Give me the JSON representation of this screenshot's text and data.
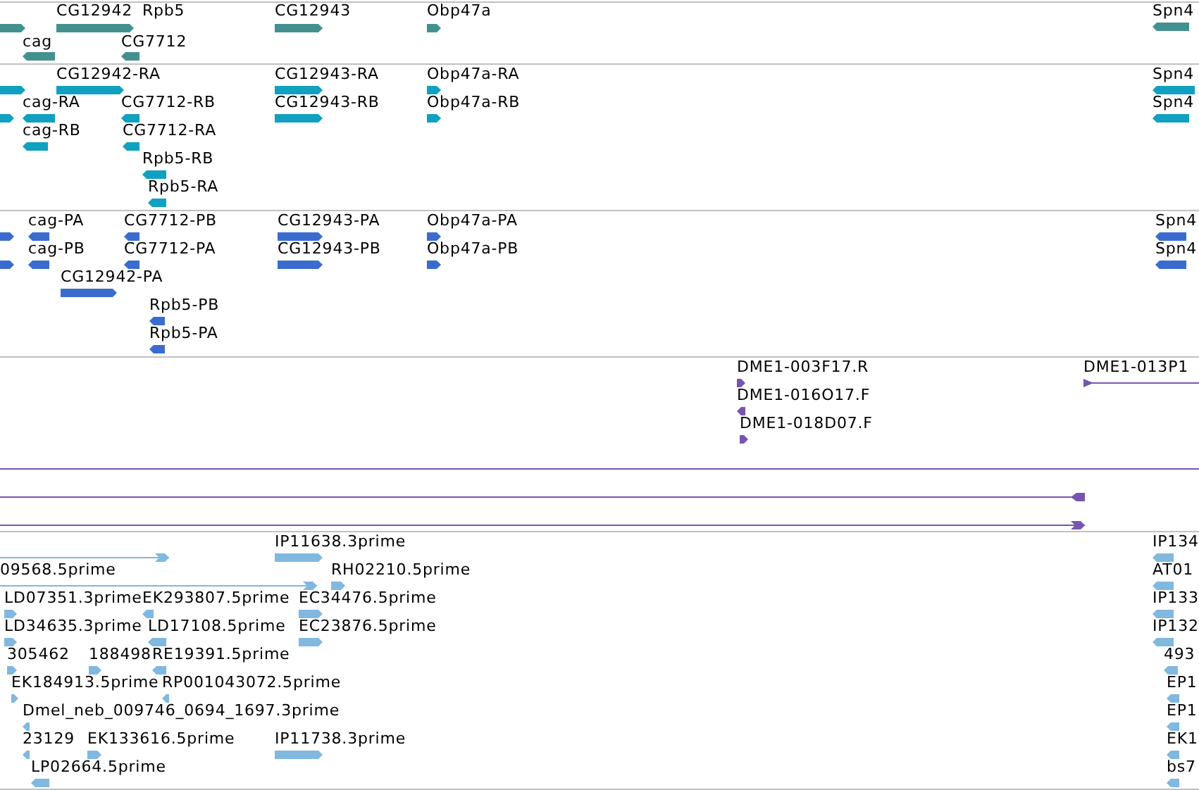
{
  "tracks": [
    {
      "color": "#43918f",
      "features": [
        {
          "kind": "block",
          "reverse": false
        },
        {
          "label": "CG12942",
          "kind": "block",
          "reverse": false
        },
        {
          "label": "Rpb5",
          "kind": "label"
        },
        {
          "label": "CG12943",
          "kind": "block",
          "reverse": false
        },
        {
          "label": "Obp47a",
          "kind": "block",
          "reverse": false
        },
        {
          "label": "Spn4",
          "kind": "block",
          "reverse": true
        },
        {
          "label": "cag",
          "kind": "block",
          "reverse": true
        },
        {
          "label": "CG7712",
          "kind": "block",
          "reverse": true
        }
      ]
    },
    {
      "color": "#10a0c0",
      "features": [
        {
          "kind": "block",
          "reverse": false
        },
        {
          "label": "CG12942-RA",
          "kind": "block",
          "reverse": false
        },
        {
          "label": "CG12943-RA",
          "kind": "block",
          "reverse": false
        },
        {
          "label": "Obp47a-RA",
          "kind": "block",
          "reverse": false
        },
        {
          "label": "Spn4",
          "kind": "block",
          "reverse": true
        },
        {
          "kind": "block",
          "reverse": false
        },
        {
          "label": "cag-RA",
          "kind": "block",
          "reverse": true
        },
        {
          "label": "CG7712-RB",
          "kind": "block",
          "reverse": true
        },
        {
          "label": "CG12943-RB",
          "kind": "block",
          "reverse": false
        },
        {
          "label": "Obp47a-RB",
          "kind": "block",
          "reverse": false
        },
        {
          "label": "Spn4",
          "kind": "block",
          "reverse": true
        },
        {
          "label": "cag-RB",
          "kind": "block",
          "reverse": true
        },
        {
          "label": "CG7712-RA",
          "kind": "block",
          "reverse": true
        },
        {
          "label": "Rpb5-RB",
          "kind": "block",
          "reverse": true
        },
        {
          "label": "Rpb5-RA",
          "kind": "block",
          "reverse": true
        }
      ]
    },
    {
      "color": "#3a6cd0",
      "features": [
        {
          "kind": "block",
          "reverse": false
        },
        {
          "label": "cag-PA",
          "kind": "block",
          "reverse": true
        },
        {
          "label": "CG7712-PB",
          "kind": "block",
          "reverse": true
        },
        {
          "label": "CG12943-PA",
          "kind": "block",
          "reverse": false
        },
        {
          "label": "Obp47a-PA",
          "kind": "block",
          "reverse": false
        },
        {
          "label": "Spn4",
          "kind": "block",
          "reverse": true
        },
        {
          "kind": "block",
          "reverse": false
        },
        {
          "label": "cag-PB",
          "kind": "block",
          "reverse": true
        },
        {
          "label": "CG7712-PA",
          "kind": "block",
          "reverse": true
        },
        {
          "label": "CG12943-PB",
          "kind": "block",
          "reverse": false
        },
        {
          "label": "Obp47a-PB",
          "kind": "block",
          "reverse": false
        },
        {
          "label": "Spn4",
          "kind": "block",
          "reverse": true
        },
        {
          "label": "CG12942-PA",
          "kind": "block",
          "reverse": false
        },
        {
          "label": "Rpb5-PB",
          "kind": "block",
          "reverse": true
        },
        {
          "label": "Rpb5-PA",
          "kind": "block",
          "reverse": true
        }
      ]
    },
    {
      "color": "#7655b0",
      "features": [
        {
          "label": "DME1-003F17.R",
          "kind": "block",
          "reverse": false
        },
        {
          "label": "DME1-013P1",
          "kind": "line",
          "reverse": false
        },
        {
          "label": "DME1-016O17.F",
          "kind": "block",
          "reverse": true
        },
        {
          "label": "DME1-018D07.F",
          "kind": "block",
          "reverse": false
        },
        {
          "kind": "plain_line"
        },
        {
          "kind": "line",
          "reverse": true
        },
        {
          "kind": "line",
          "reverse": false
        }
      ]
    },
    {
      "color": "#80b8e0",
      "features": [
        {
          "label": "IP11638.3prime",
          "kind": "block",
          "reverse": false
        },
        {
          "label": "IP134",
          "kind": "block",
          "reverse": true
        },
        {
          "kind": "line",
          "reverse": false
        },
        {
          "label": "09568.5prime",
          "kind": "line",
          "reverse": false
        },
        {
          "label": "RH02210.5prime",
          "kind": "block",
          "reverse": false
        },
        {
          "label": "AT01",
          "kind": "block",
          "reverse": true
        },
        {
          "label": "LD07351.3prime",
          "kind": "block",
          "reverse": false
        },
        {
          "label": "EK293807.5prime",
          "kind": "block",
          "reverse": true
        },
        {
          "label": "EC34476.5prime",
          "kind": "block",
          "reverse": false
        },
        {
          "label": "IP133",
          "kind": "block",
          "reverse": true
        },
        {
          "label": "LD34635.3prime",
          "kind": "block",
          "reverse": false
        },
        {
          "label": "LD17108.5prime",
          "kind": "block",
          "reverse": true
        },
        {
          "label": "EC23876.5prime",
          "kind": "block",
          "reverse": false
        },
        {
          "label": "IP132",
          "kind": "block",
          "reverse": true
        },
        {
          "label": "305462",
          "kind": "block",
          "reverse": false
        },
        {
          "label": "188498",
          "kind": "block",
          "reverse": false
        },
        {
          "label": "RE19391.5prime",
          "kind": "block",
          "reverse": true
        },
        {
          "label": "493",
          "kind": "block",
          "reverse": true
        },
        {
          "label": "EK184913.5prime",
          "kind": "block",
          "reverse": false
        },
        {
          "label": "RP001043072.5prime",
          "kind": "block",
          "reverse": true
        },
        {
          "label": "EP1",
          "kind": "block",
          "reverse": true
        },
        {
          "label": "Dmel_neb_009746_0694_1697.3prime",
          "kind": "block",
          "reverse": true
        },
        {
          "label": "EP1",
          "kind": "block",
          "reverse": true
        },
        {
          "label": "23129",
          "kind": "block",
          "reverse": true
        },
        {
          "label": "EK133616.5prime",
          "kind": "block",
          "reverse": false
        },
        {
          "label": "IP11738.3prime",
          "kind": "block",
          "reverse": false
        },
        {
          "label": "EK1",
          "kind": "block",
          "reverse": true
        },
        {
          "label": "LP02664.5prime",
          "kind": "block",
          "reverse": true
        },
        {
          "label": "bs7",
          "kind": "block",
          "reverse": true
        }
      ]
    }
  ]
}
